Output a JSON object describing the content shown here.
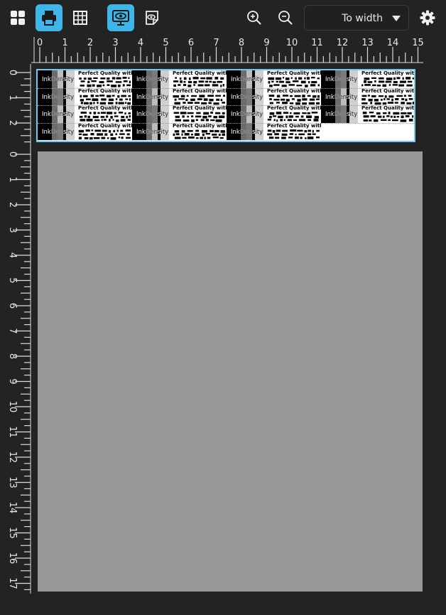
{
  "toolbar": {
    "buttons": [
      {
        "id": "layout",
        "icon": "grid-2x2-icon",
        "active": false
      },
      {
        "id": "print",
        "icon": "printer-icon",
        "active": true
      },
      {
        "id": "table",
        "icon": "table-grid-icon",
        "active": false
      },
      {
        "id": "preview-eye",
        "icon": "monitor-eye-icon",
        "active": true
      },
      {
        "id": "sticker-view",
        "icon": "sticker-eye-icon",
        "active": false
      },
      {
        "id": "zoom-in",
        "icon": "zoom-in-icon",
        "active": false
      },
      {
        "id": "zoom-out",
        "icon": "zoom-out-icon",
        "active": false
      },
      {
        "id": "settings",
        "icon": "gear-icon",
        "active": false
      }
    ],
    "zoom_value": "To width"
  },
  "ruler": {
    "horizontal_labels": [
      "0",
      "1",
      "2",
      "3",
      "4",
      "5",
      "6",
      "7",
      "8",
      "9",
      "10",
      "11",
      "12",
      "13",
      "14",
      "15"
    ],
    "strip_vertical_labels": [
      "0",
      "1",
      "2"
    ],
    "page_vertical_labels": [
      "0",
      "1",
      "2",
      "3",
      "4",
      "5",
      "6",
      "7",
      "8",
      "9",
      "10",
      "11",
      "12",
      "13",
      "14",
      "15",
      "16",
      "17"
    ]
  },
  "sheet": {
    "ink_label": "InkDensity",
    "text_line": "Perfect Quality with"
  },
  "colors": {
    "accent": "#3fb5ea",
    "selection_border": "#6fc8ef",
    "background": "#232323",
    "canvas": "#989898"
  }
}
